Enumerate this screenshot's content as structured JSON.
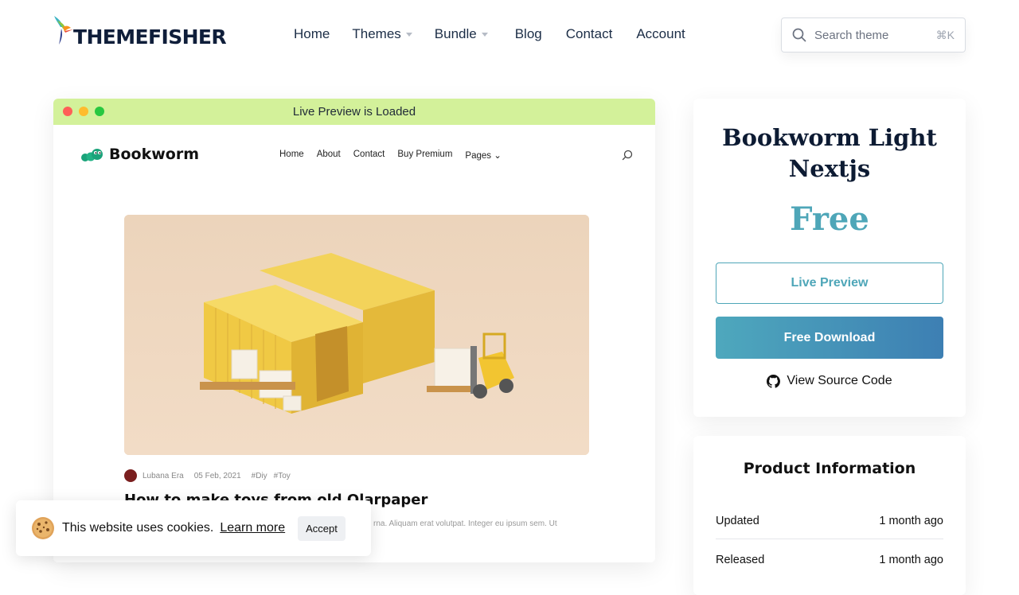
{
  "header": {
    "logo_text": "THEMEFISHER",
    "nav": [
      {
        "label": "Home",
        "dropdown": false
      },
      {
        "label": "Themes",
        "dropdown": true
      },
      {
        "label": "Bundle",
        "dropdown": true
      },
      {
        "label": "Blog",
        "dropdown": false
      },
      {
        "label": "Contact",
        "dropdown": false
      },
      {
        "label": "Account",
        "dropdown": false
      }
    ],
    "search_placeholder": "Search theme",
    "search_shortcut": "⌘K"
  },
  "preview": {
    "bar_title": "Live Preview is Loaded",
    "dot_colors": [
      "#fe5f57",
      "#febc2e",
      "#28c840"
    ],
    "bar_color": "#d3f19a",
    "site": {
      "logo_text": "Bookworm",
      "nav": [
        "Home",
        "About",
        "Contact",
        "Buy Premium",
        "Pages ⌄"
      ],
      "meta_author": "Lubana Era",
      "meta_date": "05 Feb, 2021",
      "meta_tags": [
        "#Diy",
        "#Toy"
      ],
      "post_title": "How to make toys from old Olarpaper",
      "post_excerpt": "rna. Aliquam erat volutpat. Integer eu ipsum sem. Ut"
    }
  },
  "product": {
    "title": "Bookworm Light Nextjs",
    "price": "Free",
    "live_preview_label": "Live Preview",
    "download_label": "Free Download",
    "source_label": "View Source Code",
    "accent_color": "#4ea6b8"
  },
  "info": {
    "title": "Product Information",
    "rows": [
      {
        "label": "Updated",
        "value": "1 month ago"
      },
      {
        "label": "Released",
        "value": "1 month ago"
      }
    ]
  },
  "cookie": {
    "text": "This website uses cookies.",
    "link": "Learn more",
    "button": "Accept"
  }
}
